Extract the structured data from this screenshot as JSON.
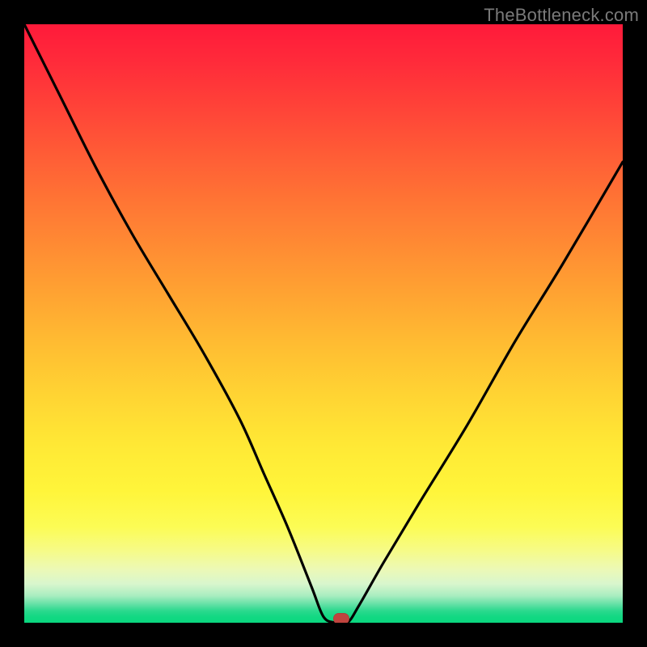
{
  "watermark": "TheBottleneck.com",
  "chart_data": {
    "type": "line",
    "title": "",
    "xlabel": "",
    "ylabel": "",
    "xlim": [
      0,
      100
    ],
    "ylim": [
      0,
      100
    ],
    "grid": false,
    "legend": false,
    "series": [
      {
        "name": "bottleneck-curve",
        "x": [
          0,
          6,
          12,
          18,
          24,
          30,
          36,
          40,
          44,
          48,
          50,
          52,
          54,
          56,
          60,
          66,
          74,
          82,
          90,
          100
        ],
        "y": [
          100,
          88,
          76,
          65,
          55,
          45,
          34,
          25,
          16,
          6,
          1,
          0,
          0,
          3,
          10,
          20,
          33,
          47,
          60,
          77
        ]
      }
    ],
    "annotations": [
      {
        "name": "min-marker",
        "x": 53,
        "y": 0.7,
        "shape": "pill",
        "color": "#c0443e"
      }
    ],
    "background_gradient": {
      "top": "#ff1a3a",
      "mid": "#ffd433",
      "bottom": "#0ad77f"
    }
  }
}
